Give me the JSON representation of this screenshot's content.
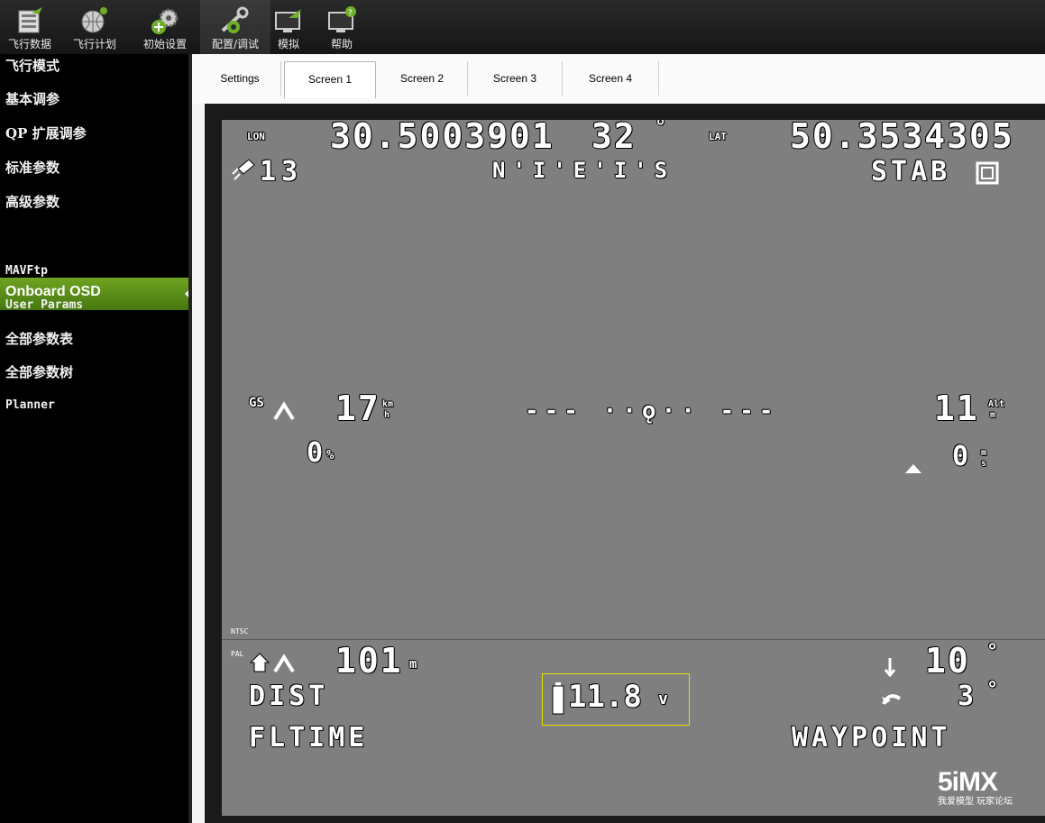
{
  "toolbar": {
    "buttons": [
      {
        "label": "飞行数据",
        "icon": "flight-data-icon"
      },
      {
        "label": "飞行计划",
        "icon": "flight-plan-icon"
      },
      {
        "label": "初始设置",
        "icon": "initial-setup-icon"
      },
      {
        "label": "配置/调试",
        "icon": "config-tuning-icon"
      },
      {
        "label": "模拟",
        "icon": "simulation-icon"
      },
      {
        "label": "帮助",
        "icon": "help-icon"
      }
    ],
    "active": "配置/调试"
  },
  "sidebar": {
    "items": [
      {
        "label": "飞行模式"
      },
      {
        "label": "基本调参"
      },
      {
        "label": "QP 扩展调参"
      },
      {
        "label": "标准参数"
      },
      {
        "label": "高级参数"
      },
      {
        "label": "Onboard OSD"
      },
      {
        "label": "MAVFtp"
      },
      {
        "label": "User Params"
      },
      {
        "label": "全部参数表"
      },
      {
        "label": "全部参数树"
      },
      {
        "label": "Planner"
      }
    ],
    "active": "Onboard OSD"
  },
  "tabs": {
    "items": [
      {
        "label": "Settings"
      },
      {
        "label": "Screen 1"
      },
      {
        "label": "Screen 2"
      },
      {
        "label": "Screen 3"
      },
      {
        "label": "Screen 4"
      }
    ],
    "active": "Screen 1"
  },
  "osd": {
    "lon_label": "LON",
    "lon_value": "30.5003901",
    "heading": "32",
    "heading_unit": "°",
    "lat_label": "LAT",
    "lat_value": "50.3534305",
    "sats": "13",
    "compass": "N'I'E'I'S",
    "flight_mode": "STAB",
    "gs_label": "GS",
    "ground_speed": "17",
    "speed_unit_top": "km",
    "speed_unit_bottom": "h",
    "throttle": "0",
    "throttle_unit": "%",
    "horizon": "--- ··ǫ·· ---",
    "altitude": "11",
    "alt_unit_top": "Alt",
    "alt_unit_bottom": "m",
    "climb": "0",
    "climb_unit_top": "m",
    "climb_unit_bottom": "s",
    "ntsc": "NTSC",
    "pal": "PAL",
    "home_dist": "101",
    "home_unit": "m",
    "dist_label": "DIST",
    "fltime_label": "FLTIME",
    "battery": "11.8",
    "battery_unit": "v",
    "pitch": "10",
    "pitch_unit": "°",
    "roll": "3",
    "roll_unit": "°",
    "waypoint_label": "WAYPOINT"
  },
  "watermark": {
    "logo": "5iMX",
    "tagline": "我爱模型 玩家论坛"
  },
  "colors": {
    "accent": "#5a9418",
    "osd_bg": "#7f7f7f",
    "battery_box": "#e8e000"
  }
}
